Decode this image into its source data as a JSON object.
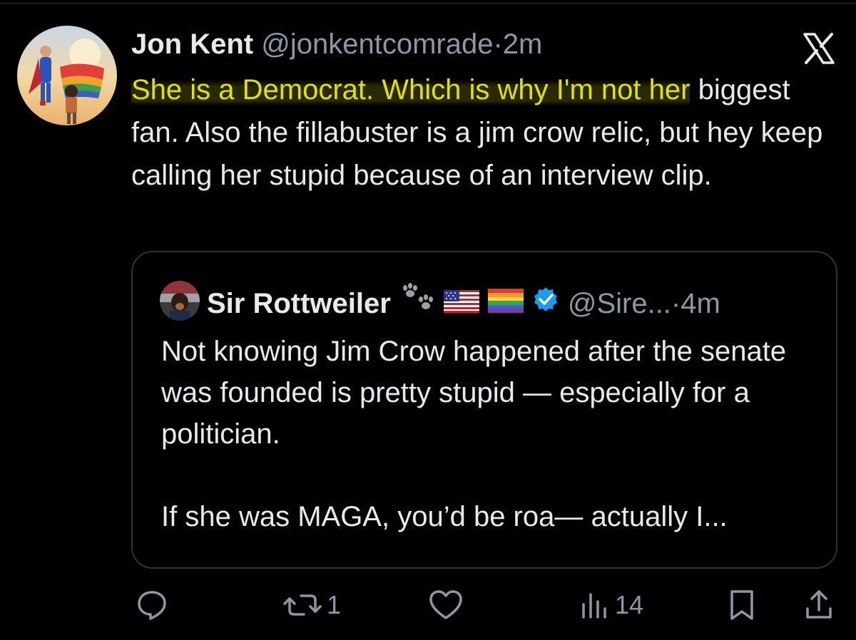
{
  "tweet": {
    "author_name": "Jon Kent",
    "author_handle": "@jonkentcomrade",
    "separator": "·",
    "time": "2m",
    "text_highlighted": "She is a Democrat. Which is why I'm not her",
    "text_rest": " biggest fan. Also the fillabuster is a jim crow relic, but hey keep calling her stupid because of an interview clip.",
    "highlight_color": "#e2e00a"
  },
  "quoted_tweet": {
    "author_name": "Sir Rottweiler",
    "author_handle": "@Sire...",
    "separator": "·",
    "time": "4m",
    "verified": true,
    "verified_color": "#1d9bf0",
    "emojis": [
      "paw-prints-icon",
      "us-flag-icon",
      "rainbow-flag-icon"
    ],
    "paragraph_1": "Not knowing Jim Crow happened after the senate was founded is pretty stupid — especially for a politician.",
    "paragraph_2": "If she was MAGA, you’d be roa— actually I..."
  },
  "actions": {
    "reply_count": "",
    "retweet_count": "1",
    "like_count": "",
    "views_count": "14"
  },
  "icons": {
    "platform": "x-logo-icon",
    "reply": "speech-bubble-icon",
    "retweet": "retweet-icon",
    "like": "heart-icon",
    "views": "bar-chart-icon",
    "bookmark": "bookmark-icon",
    "share": "share-icon"
  },
  "colors": {
    "background": "#000000",
    "text_primary": "#e7e9ea",
    "text_secondary": "#8b98a5",
    "border": "#2f3336"
  }
}
